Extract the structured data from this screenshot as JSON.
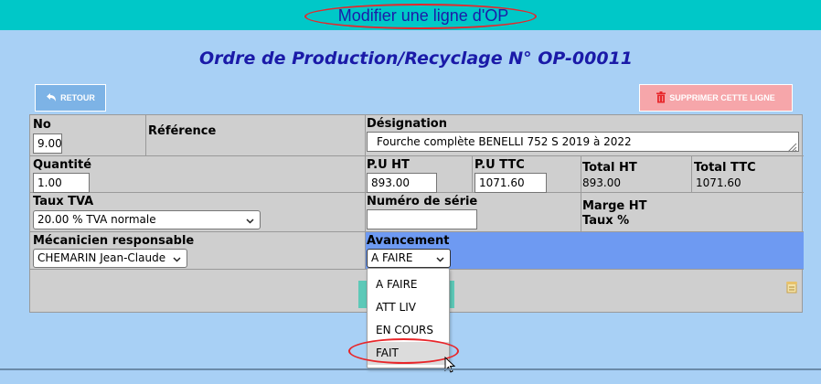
{
  "header": {
    "title": "Modifier une ligne d'OP",
    "bar_color": "#00c8c8"
  },
  "page_heading": "Ordre de Production/Recyclage N° OP-00011",
  "buttons": {
    "back_label": "RETOUR",
    "back_icon": "undo-arrow-icon",
    "delete_label": "SUPPRIMER CETTE LIGNE",
    "delete_icon": "trash-icon"
  },
  "form": {
    "no": {
      "label": "No",
      "value": "9.00"
    },
    "reference": {
      "label": "Référence"
    },
    "designation": {
      "label": "Désignation",
      "value": "Fourche complète BENELLI 752 S 2019 à 2022"
    },
    "quantite": {
      "label": "Quantité",
      "value": "1.00"
    },
    "pu_ht": {
      "label": "P.U HT",
      "value": "893.00"
    },
    "pu_ttc": {
      "label": "P.U TTC",
      "value": "1071.60"
    },
    "total_ht": {
      "label": "Total HT",
      "value": "893.00"
    },
    "total_ttc": {
      "label": "Total TTC",
      "value": "1071.60"
    },
    "taux_tva": {
      "label": "Taux TVA",
      "value": "20.00 % TVA normale"
    },
    "numero_serie": {
      "label": "Numéro de série",
      "value": ""
    },
    "marge_ht": {
      "label": "Marge HT"
    },
    "taux_pct": {
      "label": "Taux %"
    },
    "mecanicien": {
      "label": "Mécanicien responsable",
      "value": "CHEMARIN Jean-Claude"
    },
    "avancement": {
      "label": "Avancement",
      "value": "A FAIRE",
      "options": [
        "A FAIRE",
        "ATT LIV",
        "EN COURS",
        "FAIT"
      ],
      "hovered_option": "FAIT"
    }
  },
  "colors": {
    "background": "#a8d0f5",
    "title_text": "#1c1ca8",
    "highlight": "#e8262a",
    "avancement_cell": "#6e9af2"
  }
}
